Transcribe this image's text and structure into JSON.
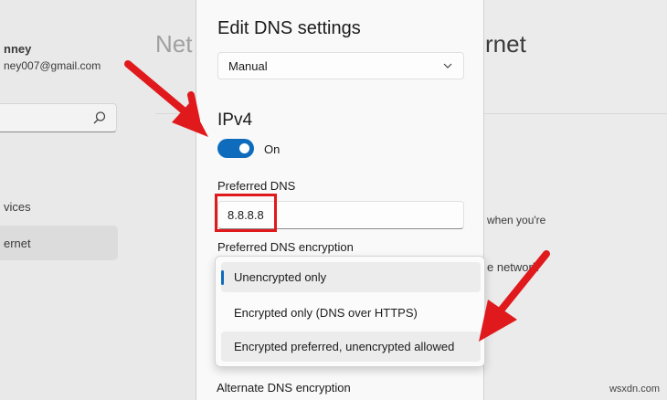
{
  "background": {
    "title_left": "Net",
    "title_right": "rnet",
    "user_name": "nney",
    "user_email": "ney007@gmail.com",
    "nav_devices": "vices",
    "nav_internet": "ernet",
    "text_when": "when you're",
    "text_network": "e network"
  },
  "dialog": {
    "title": "Edit DNS settings",
    "mode_value": "Manual",
    "section_title": "IPv4",
    "toggle_state": "On",
    "preferred_dns_label": "Preferred DNS",
    "preferred_dns_value": "8.8.8.8",
    "preferred_encryption_label": "Preferred DNS encryption",
    "alternate_encryption_label": "Alternate DNS encryption"
  },
  "dropdown": {
    "options": [
      "Unencrypted only",
      "Encrypted only (DNS over HTTPS)",
      "Encrypted preferred, unencrypted allowed"
    ],
    "selected_index": 0
  },
  "colors": {
    "accent": "#0f6cbd",
    "annotation_red": "#e0191c"
  },
  "watermark": "wsxdn.com"
}
